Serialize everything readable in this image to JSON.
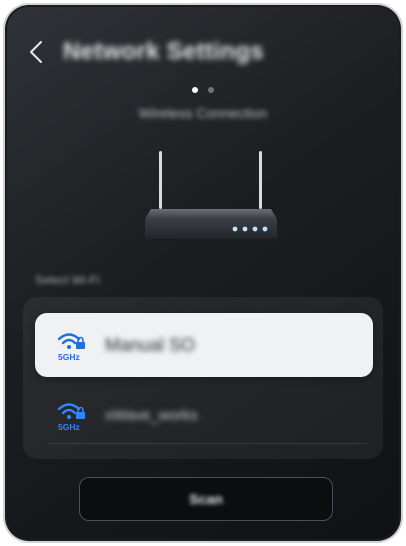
{
  "header": {
    "title": "Network Settings",
    "back_icon": "chevron-left-icon"
  },
  "pager": {
    "current_page": 1,
    "total_pages": 2
  },
  "subtitle": "Wireless Connection",
  "section_label": "Select Wi-Fi",
  "networks": [
    {
      "name": "Manual SO",
      "band": "5GHz",
      "selected": true
    },
    {
      "name": "xWave_works",
      "band": "5GHz",
      "selected": false
    }
  ],
  "scan_button": {
    "label": "Scan"
  },
  "colors": {
    "accent": "#1e6fe0",
    "background": "#1b1d20",
    "selected_row": "#f0f1f3"
  }
}
